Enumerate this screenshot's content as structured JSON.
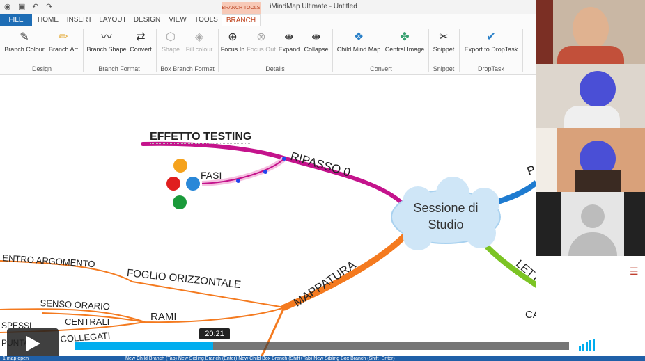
{
  "window": {
    "title": "iMindMap Ultimate - Untitled"
  },
  "context_tab": "BRANCH TOOLS",
  "tabs": [
    "FILE",
    "HOME",
    "INSERT",
    "LAYOUT",
    "DESIGN",
    "VIEW",
    "TOOLS",
    "BRANCH"
  ],
  "ribbon": {
    "buttons": {
      "branch_colour": "Branch Colour",
      "branch_art": "Branch Art",
      "branch_shape": "Branch Shape",
      "convert": "Convert",
      "shape": "Shape",
      "fill_colour": "Fill colour",
      "focus_in": "Focus In",
      "focus_out": "Focus Out",
      "expand": "Expand",
      "collapse": "Collapse",
      "child_mind_map": "Child Mind Map",
      "central_image": "Central Image",
      "snippet": "Snippet",
      "export_droptask": "Export to DropTask"
    },
    "groups": {
      "design": "Design",
      "branch_format": "Branch Format",
      "box_branch_format": "Box Branch Format",
      "details": "Details",
      "convert": "Convert",
      "snippet": "Snippet",
      "droptask": "DropTask"
    }
  },
  "map": {
    "central": [
      "Sessione di",
      "Studio"
    ],
    "branches": {
      "effetto": "EFFETTO TESTING",
      "ripasso": "RIPASSO 0",
      "fasi": "FASI",
      "mappatura": "MAPPATURA",
      "foglio": "FOGLIO ORIZZONTALE",
      "centro": "ENTRO ARGOMENTO",
      "rami": "RAMI",
      "senso": "SENSO ORARIO",
      "centrali": "CENTRALI",
      "spessi": "SPESSI",
      "collegati": "COLLEGATI",
      "punta": "PUNTA",
      "lettura": "LETTURA",
      "ca": "CA",
      "p": "P"
    }
  },
  "video": {
    "time_tooltip": "20:21",
    "progress": 0.28
  },
  "status": {
    "text": "1 map open",
    "hints": "New Child Branch (Tab)  New Sibling Branch (Enter)  New Child Box Branch (Shift+Tab)  New Sibling Box Branch (Shift+Enter)"
  },
  "colors": {
    "accent": "#c0451f",
    "file_tab": "#1e6db5",
    "ripasso": "#c4138c",
    "mappatura": "#f47a1f",
    "lettura": "#7cc424",
    "p": "#1e7bd0",
    "progress": "#00adef",
    "cloud": "#cfe6f7"
  }
}
